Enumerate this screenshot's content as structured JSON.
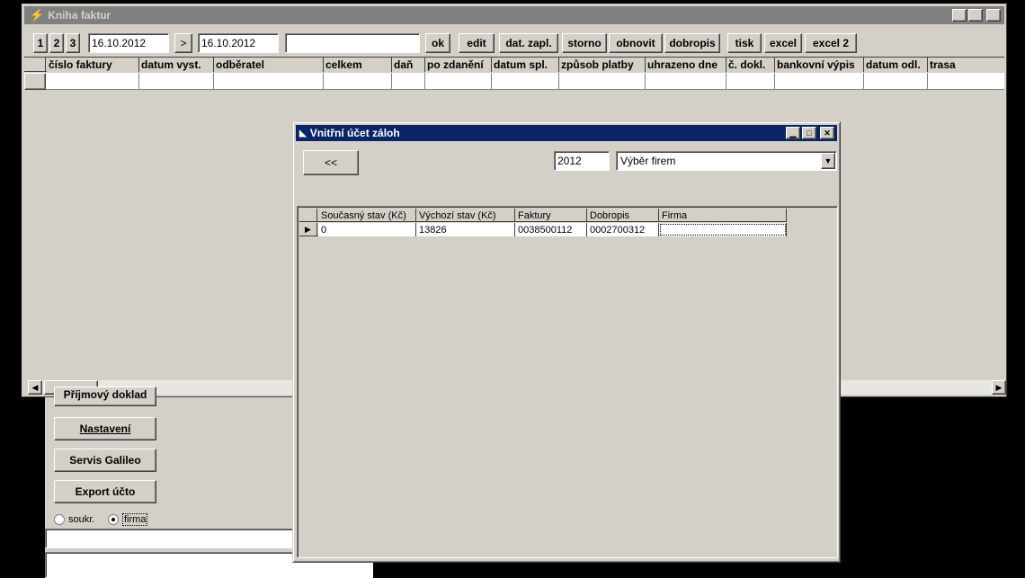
{
  "main_window": {
    "title": "Kniha faktur",
    "page_buttons": [
      "1",
      "2",
      "3"
    ],
    "date_from": "16.10.2012",
    "next_label": ">",
    "date_to": "16.10.2012",
    "filter_value": "",
    "toolbar": [
      "ok",
      "edit",
      "dat. zapl.",
      "storno",
      "obnovit",
      "dobropis",
      "tisk",
      "excel",
      "excel 2"
    ],
    "columns": [
      "číslo faktury",
      "datum vyst.",
      "odběratel",
      "celkem",
      "daň",
      "po zdanění",
      "datum spl.",
      "způsob platby",
      "uhrazeno dne",
      "č. dokl.",
      "bankovní výpis",
      "datum odl.",
      "trasa"
    ]
  },
  "side_panel": {
    "partial_button": "Příjmový doklad",
    "buttons": [
      "Nastavení",
      "Servis Galileo",
      "Export účto"
    ],
    "radio_private": "soukr.",
    "radio_company": "firma"
  },
  "dialog": {
    "title": "Vnitřní účet záloh",
    "back_label": "<<",
    "year": "2012",
    "company_select": "Výběr firem",
    "columns": [
      "Současný stav (Kč)",
      "Výchozí stav (Kč)",
      "Faktury",
      "Dobropis",
      "Firma"
    ],
    "row": [
      "0",
      "13826",
      "0038500112",
      "0002700312",
      ""
    ]
  }
}
